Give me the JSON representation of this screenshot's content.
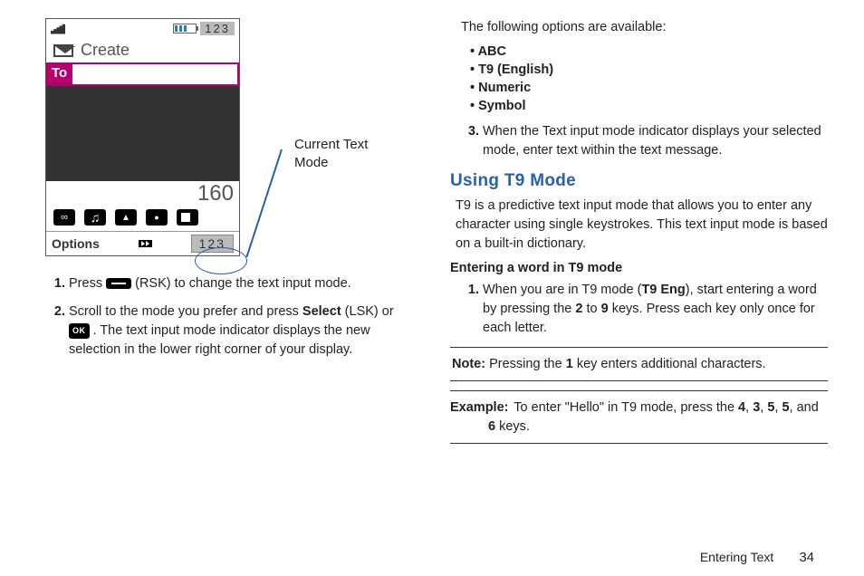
{
  "phone": {
    "mode_indicator_top": "123",
    "title": "Create",
    "to_label": "To",
    "char_counter": "160",
    "softkey_left": "Options",
    "softkey_right": "123"
  },
  "callout": {
    "line1": "Current Text",
    "line2": "Mode"
  },
  "left_steps": {
    "s1a": "Press ",
    "s1b": " (RSK) to change the text input mode.",
    "s2a": "Scroll to the mode you prefer and press ",
    "s2_select": "Select",
    "s2b": " (LSK) or ",
    "ok_label": "OK",
    "s2c": " . The text input mode indicator displays the new selection in the lower right corner of your display."
  },
  "right": {
    "intro": "The following options are available:",
    "options": [
      "ABC",
      "T9 (English)",
      "Numeric",
      "Symbol"
    ],
    "step3": "When the Text input mode indicator displays your selected mode, enter text within the text message.",
    "heading": "Using T9 Mode",
    "t9_para": "T9 is a predictive text input mode that allows you to enter any character using single keystrokes. This text input mode is based on a built-in dictionary.",
    "subhead": "Entering a word in T9 mode",
    "t9_step1a": "When you are in T9 mode (",
    "t9_eng": "T9 Eng",
    "t9_step1b": "), start entering a word by pressing the ",
    "key2": "2",
    "to_word": " to ",
    "key9": "9",
    "t9_step1c": " keys. Press each key only once for each letter.",
    "note_lbl": "Note:",
    "note_a": " Pressing the ",
    "key1": "1",
    "note_b": " key enters additional characters.",
    "ex_lbl": "Example:",
    "ex_a": " To enter \"Hello\" in T9 mode, press the ",
    "k4": "4",
    "c1": ", ",
    "k3": "3",
    "c2": ", ",
    "k5a": "5",
    "c3": ", ",
    "k5b": "5",
    "c4": ", and ",
    "k6": "6",
    "ex_b": " keys."
  },
  "footer": {
    "section": "Entering Text",
    "page": "34"
  }
}
